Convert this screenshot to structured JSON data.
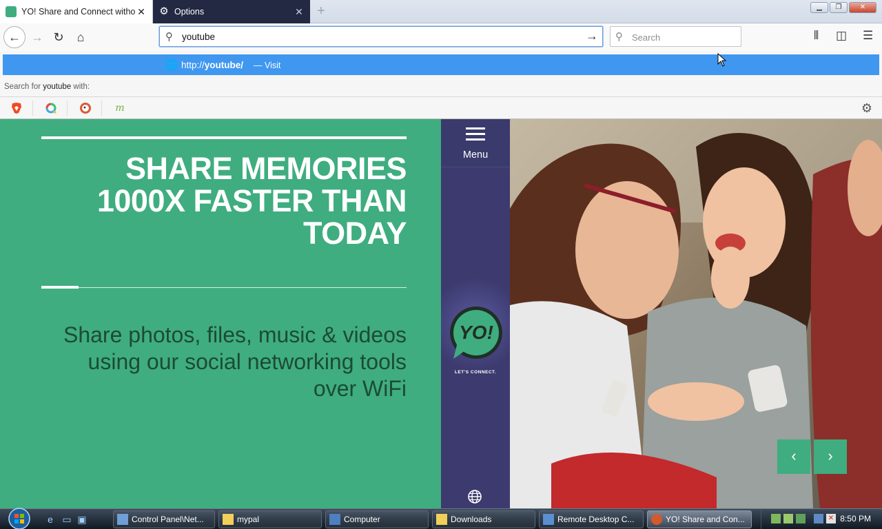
{
  "browser": {
    "tabs": [
      {
        "title": "YO! Share and Connect without",
        "active": true
      },
      {
        "title": "Options",
        "active": false
      }
    ],
    "urlbar": {
      "value": "youtube"
    },
    "searchbar": {
      "placeholder": "Search"
    },
    "suggestion": {
      "url_prefix": "http://",
      "url_bold": "youtube/",
      "visit": "— Visit"
    },
    "search_for": {
      "prefix": "Search for ",
      "term": "youtube",
      "suffix": " with:"
    },
    "engines": [
      "brave-search",
      "qwant",
      "duckduckgo",
      "mojeek"
    ]
  },
  "page": {
    "headline": [
      "SHARE MEMORIES",
      "1000X FASTER THAN",
      "TODAY"
    ],
    "subtitle": [
      "Share photos, files, music & videos",
      "using our social networking tools",
      "over WiFi"
    ],
    "menu_label": "Menu",
    "logo_text": "YO!",
    "tagline": "LET'S CONNECT.",
    "colors": {
      "hero": "#3fad7f",
      "sidebar": "#3c3a6e",
      "accent": "#3f97f0"
    }
  },
  "taskbar": {
    "buttons": [
      {
        "label": "Control Panel\\Net...",
        "icon": "control-panel-icon"
      },
      {
        "label": "mypal",
        "icon": "folder-icon"
      },
      {
        "label": "Computer",
        "icon": "computer-icon"
      },
      {
        "label": "Downloads",
        "icon": "folder-icon"
      },
      {
        "label": "Remote Desktop C...",
        "icon": "remote-desktop-icon"
      },
      {
        "label": "YO! Share and Con...",
        "icon": "browser-icon"
      }
    ],
    "clock": "8:50 PM"
  }
}
